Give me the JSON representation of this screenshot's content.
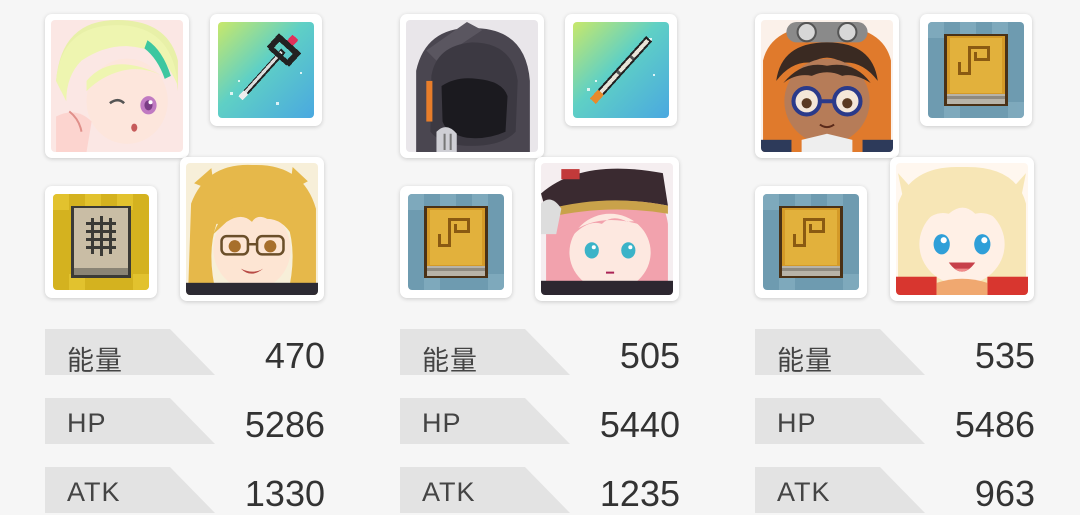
{
  "teams": [
    {
      "characters": [
        {
          "icon": "green-haired-girl-portrait-icon"
        },
        {
          "icon": "glasses-blonde-girl-portrait-icon"
        }
      ],
      "items": [
        {
          "icon": "pixel-staff-icon"
        },
        {
          "icon": "pixel-gold-spellbook-icon"
        }
      ],
      "stats": [
        {
          "label": "能量",
          "value": "470"
        },
        {
          "label": "HP",
          "value": "5286"
        },
        {
          "label": "ATK",
          "value": "1330"
        }
      ]
    },
    {
      "characters": [
        {
          "icon": "hooded-knight-portrait-icon"
        },
        {
          "icon": "pink-haired-captain-portrait-icon"
        }
      ],
      "items": [
        {
          "icon": "pixel-wand-icon"
        },
        {
          "icon": "pixel-spellbook-icon"
        }
      ],
      "stats": [
        {
          "label": "能量",
          "value": "505"
        },
        {
          "label": "HP",
          "value": "5440"
        },
        {
          "label": "ATK",
          "value": "1235"
        }
      ]
    },
    {
      "characters": [
        {
          "icon": "goggles-boy-portrait-icon"
        },
        {
          "icon": "blonde-blue-eyed-girl-portrait-icon"
        }
      ],
      "items": [
        {
          "icon": "pixel-spellbook-icon"
        },
        {
          "icon": "pixel-spellbook-icon"
        }
      ],
      "stats": [
        {
          "label": "能量",
          "value": "535"
        },
        {
          "label": "HP",
          "value": "5486"
        },
        {
          "label": "ATK",
          "value": "963"
        }
      ]
    }
  ],
  "colors": {
    "background": "#f6f6f6",
    "stat_band": "#e3e3e3",
    "item_teal": "#5fc7c9",
    "item_blue": "#6e9bb0",
    "item_gold": "#d4b21f"
  }
}
